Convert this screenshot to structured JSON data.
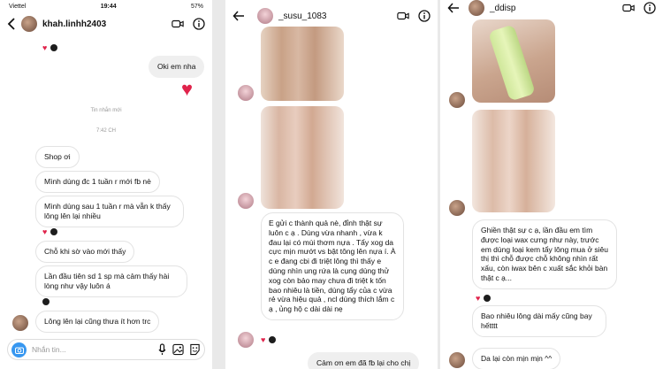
{
  "panel1": {
    "status": {
      "carrier": "Viettel",
      "time": "19:44",
      "battery": "57%"
    },
    "username": "khah.linhh2403",
    "messages": {
      "okie": "Oki em nha",
      "separator": "Tin nhắn mới",
      "time": "7:42 CH",
      "m1": "Shop ơi",
      "m2": "Mình dùng đc 1 tuần r mới fb nè",
      "m3": "Mình dùng sau 1 tuần r mà vẫn k thấy lông lên lại nhiều",
      "m4": "Chỗ khi sờ vào mới thấy",
      "m5": "Lần đầu tiên sd 1 sp mà cảm thấy hài lòng như vậy luôn á",
      "m6": "Lông lên lại cũng thưa ít hơn trc"
    },
    "composer_placeholder": "Nhắn tin..."
  },
  "panel2": {
    "username": "_susu_1083",
    "review": "E gửi c thành quả nè, đỉnh thật sự luôn c ạ . Dùng vừa nhanh , vừa k đau lại có mùi thơm nựa . Tẩy xog da cực mịn mướt  vs bật tông lên nựa í. À c e đang cbi đi triệt lông thì thấy e dùng nhìn ung rứa là cụng dùng thử xog còn bảo may chưa đi triệt k tốn bao nhiêu là tiền, dùng tẩy của c vừa rẻ vừa hiệu quả , ncl dùng thích lắm c ạ , ủng hộ c dài dài nẹ",
    "reply": "Cảm ơn em đã fb lại cho chị"
  },
  "panel3": {
    "username": "_ddisp",
    "review": "Ghiền thật sự c ạ, lần đầu em tìm được loại wax cưng như này, trước em dùng loại kem tẩy lông mua ở siêu thị thì chỗ được chỗ không nhìn rất xấu, còn iwax bên c xuất sắc khỏi bàn thật c ạ...",
    "m2": "Bao nhiêu lông dài mấy cũng bay hếtttt",
    "m3": "Da lại còn mịn mịn ^^"
  },
  "colors": {
    "accent": "#3797f0",
    "heart": "#e0234b"
  }
}
